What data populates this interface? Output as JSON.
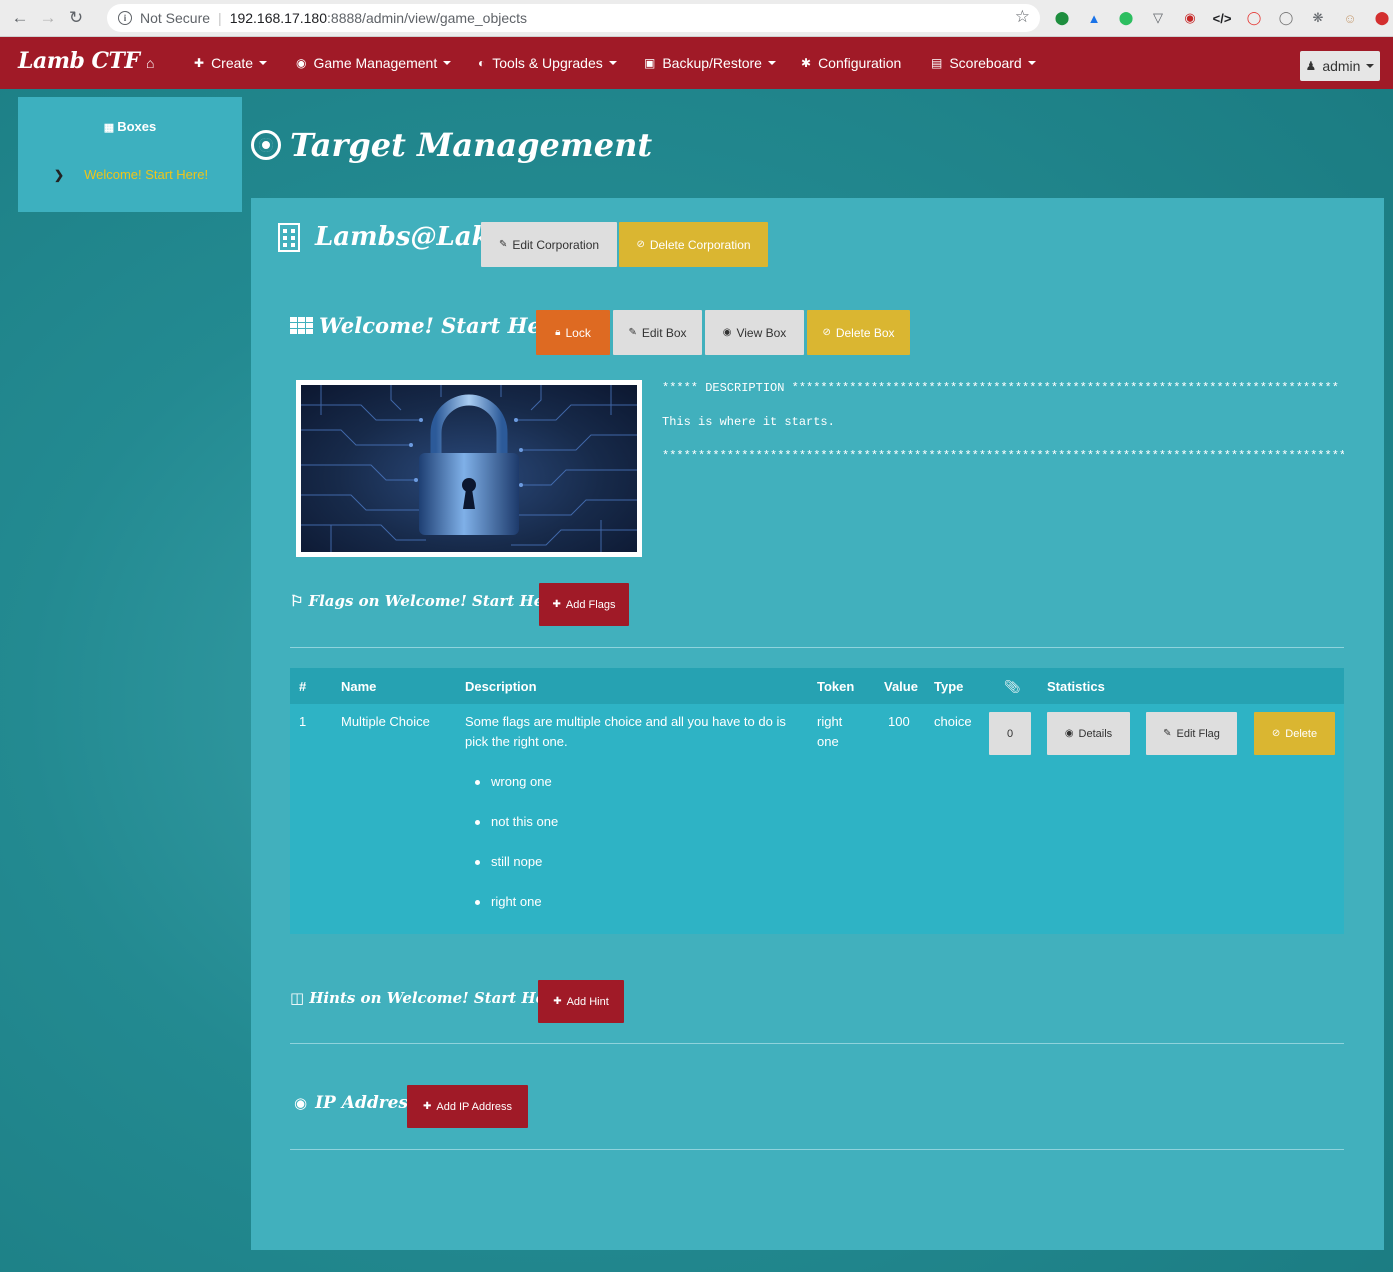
{
  "browser": {
    "security": "Not Secure",
    "url_host": "192.168.17.180",
    "url_rest": ":8888/admin/view/game_objects"
  },
  "navbar": {
    "brand": "Lamb CTF",
    "items": [
      {
        "label": "Create",
        "icon": "plus-icon"
      },
      {
        "label": "Game Management",
        "icon": "eye-icon"
      },
      {
        "label": "Tools & Upgrades",
        "icon": "binoculars-icon"
      },
      {
        "label": "Backup/Restore",
        "icon": "floppy-icon"
      },
      {
        "label": "Configuration",
        "icon": "gear-icon"
      },
      {
        "label": "Scoreboard",
        "icon": "bar-chart-icon"
      }
    ],
    "user": "admin"
  },
  "sidebar": {
    "heading": "Boxes",
    "items": [
      {
        "label": "Welcome! Start Here!"
      }
    ]
  },
  "page": {
    "title": "Target Management"
  },
  "corporation": {
    "name": "Lambs@Lake",
    "edit_label": "Edit Corporation",
    "delete_label": "Delete Corporation"
  },
  "box": {
    "name": "Welcome! Start Here!",
    "lock_label": "Lock",
    "edit_label": "Edit Box",
    "view_label": "View Box",
    "delete_label": "Delete Box",
    "description": {
      "header": "***** DESCRIPTION ****************************************************************************",
      "body": "This is where it starts.",
      "footer": "******************************************************************************************************"
    }
  },
  "flags": {
    "title": "Flags on Welcome! Start Here!",
    "add_label": "Add Flags",
    "columns": [
      "#",
      "Name",
      "Description",
      "Token",
      "Value",
      "Type",
      "Statistics"
    ],
    "rows": [
      {
        "num": "1",
        "name": "Multiple Choice",
        "description": "Some flags are multiple choice and all you have to do is pick the right one.",
        "choices": [
          "wrong one",
          "not this one",
          "still nope",
          "right one"
        ],
        "token": "right one",
        "value": "100",
        "type": "choice",
        "attachments": "0",
        "details_label": "Details",
        "edit_label": "Edit Flag",
        "delete_label": "Delete"
      }
    ]
  },
  "hints": {
    "title": "Hints on Welcome! Start Here!",
    "add_label": "Add Hint"
  },
  "ip": {
    "title": "IP Address",
    "add_label": "Add IP Address"
  },
  "colors": {
    "navbar": "#a01a27",
    "panel": "#41b0bd",
    "accent_yellow": "#dab631",
    "accent_orange": "#de6a22",
    "sidebar_active": "#f0c419"
  }
}
